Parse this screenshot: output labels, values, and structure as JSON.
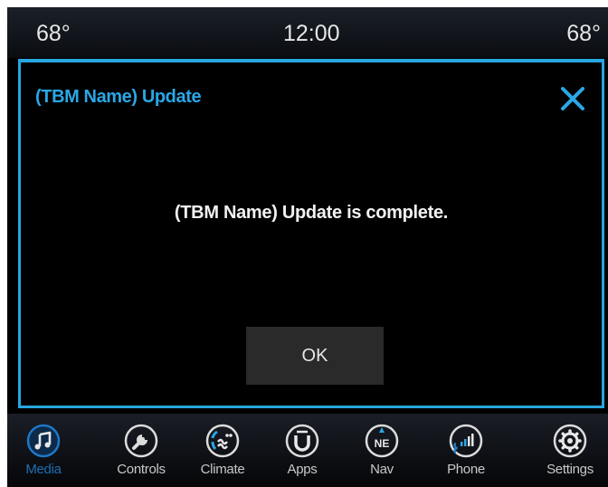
{
  "status": {
    "temp_left": "68°",
    "clock": "12:00",
    "temp_right": "68°"
  },
  "dialog": {
    "title": "(TBM Name) Update",
    "message": "(TBM Name) Update is complete.",
    "ok_label": "OK",
    "close_icon": "close-icon"
  },
  "nav": {
    "items": [
      {
        "label": "Media",
        "icon": "music-note-icon",
        "active": true
      },
      {
        "label": "Controls",
        "icon": "wrench-icon",
        "active": false
      },
      {
        "label": "Climate",
        "icon": "climate-fan-icon",
        "active": false
      },
      {
        "label": "Apps",
        "icon": "uconnect-icon",
        "active": false
      },
      {
        "label": "Nav",
        "icon": "compass-ne-icon",
        "active": false
      },
      {
        "label": "Phone",
        "icon": "phone-signal-icon",
        "active": false
      },
      {
        "label": "Settings",
        "icon": "gear-icon",
        "active": false
      }
    ]
  },
  "colors": {
    "accent": "#2aa7e6",
    "active_nav": "#1e6fb3",
    "dialog_border": "#28a6df"
  }
}
